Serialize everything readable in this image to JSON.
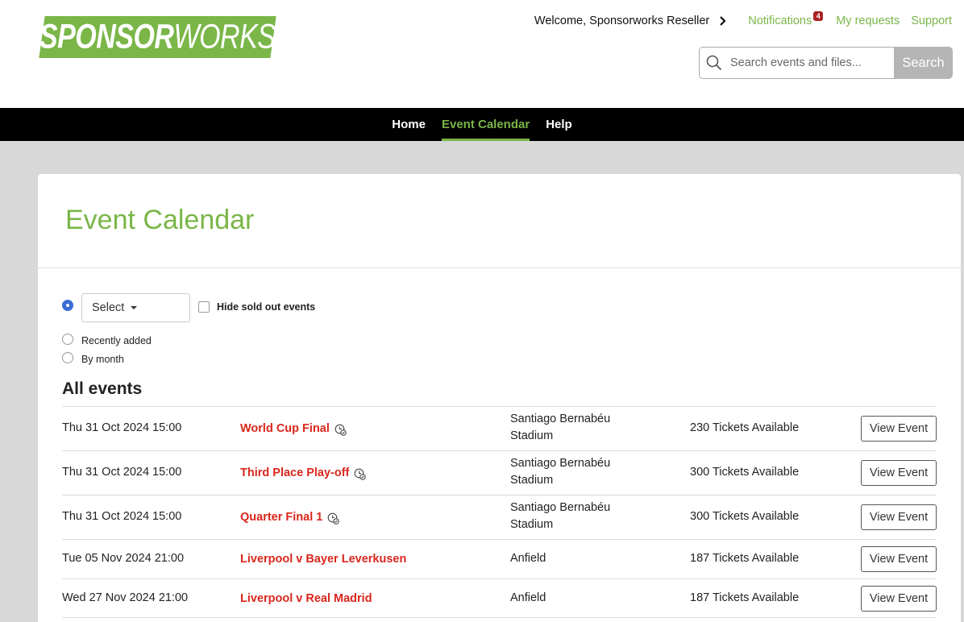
{
  "brand": {
    "logo_part1": "SPONSOR",
    "logo_part2": "WORKS",
    "accent": "#7ab648"
  },
  "topnav": {
    "welcome": "Welcome, Sponsorworks Reseller",
    "notifications_label": "Notifications",
    "notifications_count": "4",
    "requests_label": "My requests",
    "support_label": "Support"
  },
  "search": {
    "placeholder": "Search events and files...",
    "button_label": "Search"
  },
  "mainnav": {
    "items": [
      "Home",
      "Event Calendar",
      "Help"
    ],
    "active": "Event Calendar"
  },
  "page": {
    "title": "Event Calendar",
    "section_title": "All events"
  },
  "filters": {
    "select_label": "Select",
    "hide_sold_out_label": "Hide sold out events",
    "hide_sold_out_checked": false,
    "radio_options": [
      "Recently added",
      "By month"
    ]
  },
  "events": [
    {
      "date": "Thu 31 Oct 2024 15:00",
      "name": "World Cup Final",
      "venue": "Santiago Bernabéu Stadium",
      "tickets": "230 Tickets Available",
      "has_icon": true,
      "icon": "ticket-clock-icon",
      "button": "View Event"
    },
    {
      "date": "Thu 31 Oct 2024 15:00",
      "name": "Third Place Play-off",
      "venue": "Santiago Bernabéu Stadium",
      "tickets": "300 Tickets Available",
      "has_icon": true,
      "icon": "ticket-clock-icon",
      "button": "View Event"
    },
    {
      "date": "Thu 31 Oct 2024 15:00",
      "name": "Quarter Final 1",
      "venue": "Santiago Bernabéu Stadium",
      "tickets": "300 Tickets Available",
      "has_icon": true,
      "icon": "ticket-clock-icon",
      "button": "View Event"
    },
    {
      "date": "Tue 05 Nov 2024 21:00",
      "name": "Liverpool v Bayer Leverkusen",
      "venue": "Anfield",
      "tickets": "187 Tickets Available",
      "has_icon": false,
      "button": "View Event"
    },
    {
      "date": "Wed 27 Nov 2024 21:00",
      "name": "Liverpool v Real Madrid",
      "venue": "Anfield",
      "tickets": "187 Tickets Available",
      "has_icon": false,
      "button": "View Event"
    }
  ]
}
